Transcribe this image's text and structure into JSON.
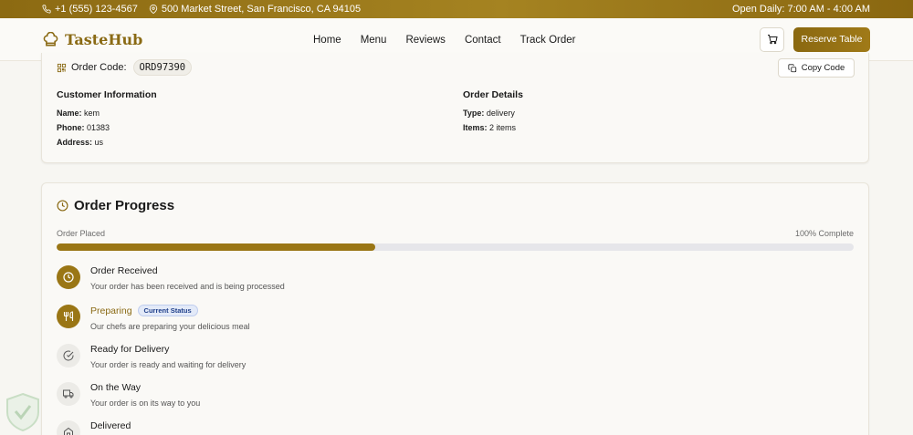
{
  "topbar": {
    "phone": "+1 (555) 123-4567",
    "address": "500 Market Street, San Francisco, CA 94105",
    "hours": "Open Daily: 7:00 AM - 4:00 AM"
  },
  "nav": {
    "brand": "TasteHub",
    "links": [
      "Home",
      "Menu",
      "Reviews",
      "Contact",
      "Track Order"
    ],
    "reserve": "Reserve Table"
  },
  "order": {
    "code_label": "Order Code:",
    "code": "ORD97390",
    "copy_label": "Copy Code",
    "customer": {
      "heading": "Customer Information",
      "name_label": "Name:",
      "name": "kem",
      "phone_label": "Phone:",
      "phone": "01383",
      "address_label": "Address:",
      "address": "us"
    },
    "details": {
      "heading": "Order Details",
      "type_label": "Type:",
      "type": "delivery",
      "items_label": "Items:",
      "items": "2 items"
    }
  },
  "progress": {
    "title": "Order Progress",
    "left_label": "Order Placed",
    "right_label": "100% Complete",
    "fill_fraction": 0.4,
    "steps": [
      {
        "title": "Order Received",
        "desc": "Your order has been received and is being processed",
        "state": "active",
        "icon": "clock-icon"
      },
      {
        "title": "Preparing",
        "desc": "Our chefs are preparing your delicious meal",
        "state": "current",
        "badge": "Current Status",
        "icon": "utensils-icon"
      },
      {
        "title": "Ready for Delivery",
        "desc": "Your order is ready and waiting for delivery",
        "state": "pending",
        "icon": "check-circle-icon"
      },
      {
        "title": "On the Way",
        "desc": "Your order is on its way to you",
        "state": "pending",
        "icon": "truck-icon"
      },
      {
        "title": "Delivered",
        "desc": "",
        "state": "pending",
        "icon": "home-icon"
      }
    ]
  },
  "colors": {
    "accent": "#9a7615",
    "badge_bg": "#e3eaf8",
    "badge_text": "#1f3f8a"
  }
}
